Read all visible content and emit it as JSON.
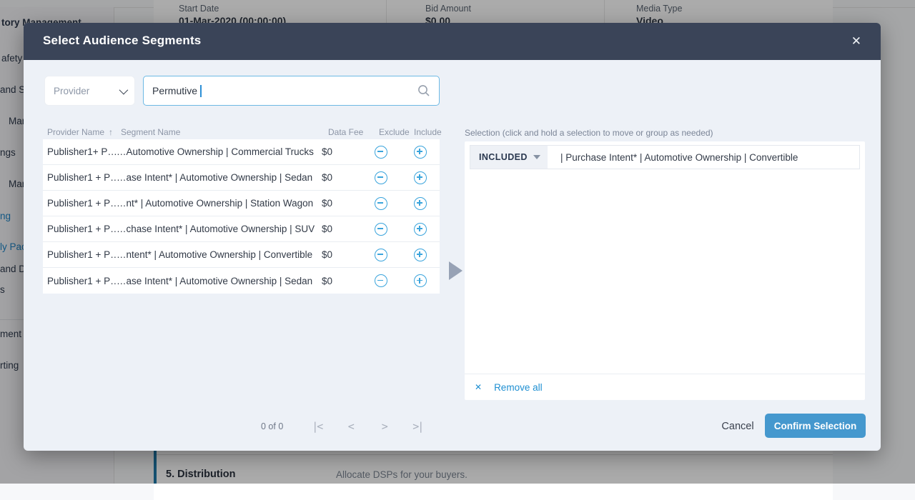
{
  "background": {
    "sidebar_items": [
      {
        "label": "tory Management",
        "blue": false,
        "bold": true
      },
      {
        "label": "afety",
        "blue": false,
        "bold": false
      },
      {
        "label": "and S",
        "blue": false,
        "bold": false
      },
      {
        "label": "Mana",
        "blue": false,
        "bold": false
      },
      {
        "label": "ngs",
        "blue": false,
        "bold": false
      },
      {
        "label": "Mana",
        "blue": false,
        "bold": false
      },
      {
        "label": "ng",
        "blue": true,
        "bold": false
      },
      {
        "label": "ly Pac",
        "blue": true,
        "bold": false
      },
      {
        "label": "and D",
        "blue": false,
        "bold": false
      },
      {
        "label": "s",
        "blue": false,
        "bold": false
      },
      {
        "label": "ment",
        "blue": false,
        "bold": false
      },
      {
        "label": "rting",
        "blue": false,
        "bold": false
      }
    ],
    "topbar": {
      "start_date_label": "Start Date",
      "start_date_value": "01-Mar-2020 (00:00:00)",
      "bid_amount_label": "Bid Amount",
      "bid_amount_value": "$0.00",
      "media_type_label": "Media Type",
      "media_type_value": "Video"
    },
    "section": {
      "title": "5. Distribution",
      "subtitle": "Allocate DSPs for your buyers."
    }
  },
  "modal": {
    "title": "Select Audience Segments",
    "close_icon": "✕",
    "provider_dropdown": {
      "label": "Provider"
    },
    "search": {
      "value": "Permutive"
    },
    "table": {
      "columns": {
        "provider": "Provider Name",
        "sort_icon": "↑",
        "segment": "Segment Name",
        "fee": "Data Fee",
        "exclude": "Exclude",
        "include": "Include"
      },
      "rows": [
        {
          "provider": "Publisher1+ P…",
          "segment": "…Automotive Ownership | Commercial Trucks",
          "fee": "$0"
        },
        {
          "provider": "Publisher1 + P…",
          "segment": "…ase Intent* | Automotive Ownership | Sedan",
          "fee": "$0"
        },
        {
          "provider": "Publisher1 + P…",
          "segment": "…nt* | Automotive Ownership | Station Wagon",
          "fee": "$0"
        },
        {
          "provider": "Publisher1 + P…",
          "segment": "…chase Intent* | Automotive Ownership | SUV",
          "fee": "$0"
        },
        {
          "provider": "Publisher1 + P…",
          "segment": "…ntent* | Automotive Ownership | Convertible",
          "fee": "$0"
        },
        {
          "provider": "Publisher1 + P…",
          "segment": "…ase Intent* | Automotive Ownership | Sedan",
          "fee": "$0"
        }
      ]
    },
    "selection": {
      "label": "Selection (click and hold a selection to move or group as needed)",
      "items": [
        {
          "state": "INCLUDED",
          "text": "| Purchase Intent* | Automotive Ownership | Convertible"
        }
      ],
      "remove_all_icon": "✕",
      "remove_all_label": "Remove all"
    },
    "pagination": {
      "count": "0 of 0",
      "first": "|<",
      "prev": "<",
      "next": ">",
      "last": ">|"
    },
    "footer": {
      "cancel_label": "Cancel",
      "confirm_label": "Confirm Selection"
    }
  },
  "colors": {
    "modal_header": "#3a4458",
    "accent_blue": "#3aa4dc",
    "confirm_button": "#4598ce",
    "link_blue": "#1e8fd2",
    "modal_body": "#edf1f7",
    "sidebar_active": "#1d84c6"
  }
}
